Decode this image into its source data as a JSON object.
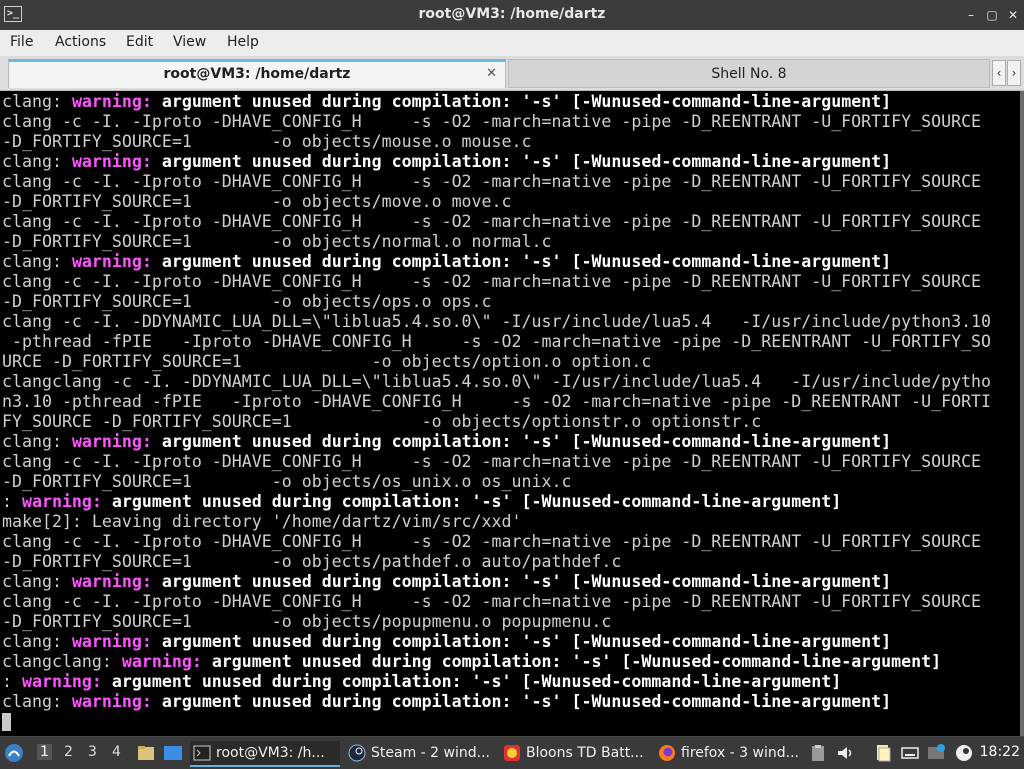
{
  "window": {
    "title": "root@VM3: /home/dartz",
    "app_icon_text": ">_"
  },
  "controls": {
    "minimize": "–",
    "maximize": "▢",
    "close": "✕"
  },
  "menu": [
    "File",
    "Actions",
    "Edit",
    "View",
    "Help"
  ],
  "tabs": [
    {
      "label": "root@VM3: /home/dartz",
      "active": true,
      "close": "✕"
    },
    {
      "label": "Shell No. 8",
      "active": false
    }
  ],
  "tab_scroll": {
    "left": "‹",
    "right": "›"
  },
  "terminal_lines": [
    [
      [
        "clang: ",
        "n"
      ],
      [
        "warning: ",
        "w"
      ],
      [
        "argument unused during compilation: '-s' [-Wunused-command-line-argument]",
        "b"
      ]
    ],
    [
      [
        "clang -c -I. -Iproto -DHAVE_CONFIG_H     -s -O2 -march=native -pipe -D_REENTRANT -U_FORTIFY_SOURCE",
        "n"
      ]
    ],
    [
      [
        "-D_FORTIFY_SOURCE=1        -o objects/mouse.o mouse.c",
        "n"
      ]
    ],
    [
      [
        "clang: ",
        "n"
      ],
      [
        "warning: ",
        "w"
      ],
      [
        "argument unused during compilation: '-s' [-Wunused-command-line-argument]",
        "b"
      ]
    ],
    [
      [
        "clang -c -I. -Iproto -DHAVE_CONFIG_H     -s -O2 -march=native -pipe -D_REENTRANT -U_FORTIFY_SOURCE",
        "n"
      ]
    ],
    [
      [
        "-D_FORTIFY_SOURCE=1        -o objects/move.o move.c",
        "n"
      ]
    ],
    [
      [
        "clang -c -I. -Iproto -DHAVE_CONFIG_H     -s -O2 -march=native -pipe -D_REENTRANT -U_FORTIFY_SOURCE",
        "n"
      ]
    ],
    [
      [
        "-D_FORTIFY_SOURCE=1        -o objects/normal.o normal.c",
        "n"
      ]
    ],
    [
      [
        "clang: ",
        "n"
      ],
      [
        "warning: ",
        "w"
      ],
      [
        "argument unused during compilation: '-s' [-Wunused-command-line-argument]",
        "b"
      ]
    ],
    [
      [
        "clang -c -I. -Iproto -DHAVE_CONFIG_H     -s -O2 -march=native -pipe -D_REENTRANT -U_FORTIFY_SOURCE",
        "n"
      ]
    ],
    [
      [
        "-D_FORTIFY_SOURCE=1        -o objects/ops.o ops.c",
        "n"
      ]
    ],
    [
      [
        "clang -c -I. -DDYNAMIC_LUA_DLL=\\\"liblua5.4.so.0\\\" -I/usr/include/lua5.4   -I/usr/include/python3.10",
        "n"
      ]
    ],
    [
      [
        " -pthread -fPIE   -Iproto -DHAVE_CONFIG_H     -s -O2 -march=native -pipe -D_REENTRANT -U_FORTIFY_SO",
        "n"
      ]
    ],
    [
      [
        "URCE -D_FORTIFY_SOURCE=1             -o objects/option.o option.c",
        "n"
      ]
    ],
    [
      [
        "clangclang -c -I. -DDYNAMIC_LUA_DLL=\\\"liblua5.4.so.0\\\" -I/usr/include/lua5.4   -I/usr/include/pytho",
        "n"
      ]
    ],
    [
      [
        "n3.10 -pthread -fPIE   -Iproto -DHAVE_CONFIG_H     -s -O2 -march=native -pipe -D_REENTRANT -U_FORTI",
        "n"
      ]
    ],
    [
      [
        "FY_SOURCE -D_FORTIFY_SOURCE=1             -o objects/optionstr.o optionstr.c",
        "n"
      ]
    ],
    [
      [
        "clang: ",
        "n"
      ],
      [
        "warning: ",
        "w"
      ],
      [
        "argument unused during compilation: '-s' [-Wunused-command-line-argument]",
        "b"
      ]
    ],
    [
      [
        "clang -c -I. -Iproto -DHAVE_CONFIG_H     -s -O2 -march=native -pipe -D_REENTRANT -U_FORTIFY_SOURCE",
        "n"
      ]
    ],
    [
      [
        "-D_FORTIFY_SOURCE=1        -o objects/os_unix.o os_unix.c",
        "n"
      ]
    ],
    [
      [
        ": ",
        "n"
      ],
      [
        "warning: ",
        "w"
      ],
      [
        "argument unused during compilation: '-s' [-Wunused-command-line-argument]",
        "b"
      ]
    ],
    [
      [
        "make[2]: Leaving directory '/home/dartz/vim/src/xxd'",
        "n"
      ]
    ],
    [
      [
        "clang -c -I. -Iproto -DHAVE_CONFIG_H     -s -O2 -march=native -pipe -D_REENTRANT -U_FORTIFY_SOURCE",
        "n"
      ]
    ],
    [
      [
        "-D_FORTIFY_SOURCE=1        -o objects/pathdef.o auto/pathdef.c",
        "n"
      ]
    ],
    [
      [
        "clang: ",
        "n"
      ],
      [
        "warning: ",
        "w"
      ],
      [
        "argument unused during compilation: '-s' [-Wunused-command-line-argument]",
        "b"
      ]
    ],
    [
      [
        "clang -c -I. -Iproto -DHAVE_CONFIG_H     -s -O2 -march=native -pipe -D_REENTRANT -U_FORTIFY_SOURCE",
        "n"
      ]
    ],
    [
      [
        "-D_FORTIFY_SOURCE=1        -o objects/popupmenu.o popupmenu.c",
        "n"
      ]
    ],
    [
      [
        "clang: ",
        "n"
      ],
      [
        "warning: ",
        "w"
      ],
      [
        "argument unused during compilation: '-s' [-Wunused-command-line-argument]",
        "b"
      ]
    ],
    [
      [
        "clangclang: ",
        "n"
      ],
      [
        "warning: ",
        "w"
      ],
      [
        "argument unused during compilation: '-s' [-Wunused-command-line-argument]",
        "b"
      ]
    ],
    [
      [
        ": ",
        "n"
      ],
      [
        "warning: ",
        "w"
      ],
      [
        "argument unused during compilation: '-s' [-Wunused-command-line-argument]",
        "b"
      ]
    ],
    [
      [
        "clang: ",
        "n"
      ],
      [
        "warning: ",
        "w"
      ],
      [
        "argument unused during compilation: '-s' [-Wunused-command-line-argument]",
        "b"
      ]
    ]
  ],
  "taskbar": {
    "workspaces": [
      "1",
      "2",
      "3",
      "4"
    ],
    "tasks": [
      {
        "label": "root@VM3: /h...",
        "icon": "terminal-icon",
        "active": true
      },
      {
        "label": "Steam - 2 wind...",
        "icon": "steam-icon",
        "active": false
      },
      {
        "label": "Bloons TD Batt...",
        "icon": "bloons-icon",
        "active": false
      },
      {
        "label": "firefox - 3 wind...",
        "icon": "firefox-icon",
        "active": false
      }
    ],
    "tray_icons": [
      "clipboard-icon",
      "volume-icon",
      "files-icon",
      "keyboard-icon",
      "update-icon",
      "steam-tray-icon"
    ],
    "clock": "18:22"
  }
}
